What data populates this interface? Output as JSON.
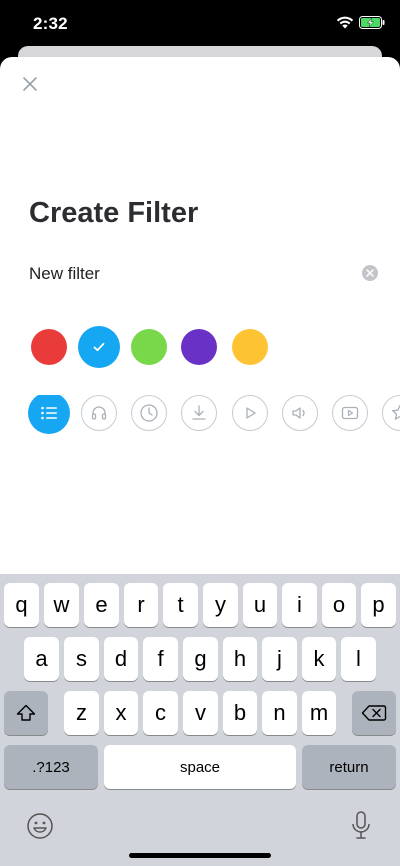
{
  "status_bar": {
    "time": "2:32"
  },
  "modal": {
    "title": "Create Filter",
    "name_value": "New filter"
  },
  "colors": {
    "swatches": [
      {
        "name": "red",
        "hex": "#ea3b3b",
        "selected": false
      },
      {
        "name": "blue",
        "hex": "#16a7f2",
        "selected": true
      },
      {
        "name": "green",
        "hex": "#78d84a",
        "selected": false
      },
      {
        "name": "purple",
        "hex": "#6a31c6",
        "selected": false
      },
      {
        "name": "yellow",
        "hex": "#fdc332",
        "selected": false
      }
    ]
  },
  "filter_icons": [
    {
      "icon": "list-icon",
      "selected": true
    },
    {
      "icon": "headphones-icon",
      "selected": false
    },
    {
      "icon": "clock-icon",
      "selected": false
    },
    {
      "icon": "download-icon",
      "selected": false
    },
    {
      "icon": "play-icon",
      "selected": false
    },
    {
      "icon": "speaker-icon",
      "selected": false
    },
    {
      "icon": "video-icon",
      "selected": false
    },
    {
      "icon": "star-icon",
      "selected": false
    }
  ],
  "keyboard": {
    "row1": [
      "q",
      "w",
      "e",
      "r",
      "t",
      "y",
      "u",
      "i",
      "o",
      "p"
    ],
    "row2": [
      "a",
      "s",
      "d",
      "f",
      "g",
      "h",
      "j",
      "k",
      "l"
    ],
    "row3": [
      "z",
      "x",
      "c",
      "v",
      "b",
      "n",
      "m"
    ],
    "numbers_label": ".?123",
    "space_label": "space",
    "return_label": "return"
  }
}
